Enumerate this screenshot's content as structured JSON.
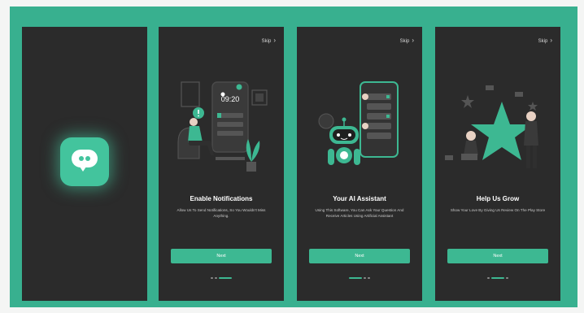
{
  "screens": [
    {
      "type": "splash",
      "app_icon": "chat-bubble-icon"
    },
    {
      "type": "onboarding",
      "skip_label": "Skip",
      "title": "Enable Notifications",
      "description": "Allow Us To Send Notifications, So You Wouldn't Miss Anything.",
      "phone_time": "09:20",
      "next_label": "Next",
      "active_dot": 2
    },
    {
      "type": "onboarding",
      "skip_label": "Skip",
      "title": "Your AI Assistant",
      "description": "Using This Software, You Can Ask Your Question And Receive Articles Using Artificial Assistant",
      "next_label": "Next",
      "active_dot": 0
    },
    {
      "type": "onboarding",
      "skip_label": "Skip",
      "title": "Help Us Grow",
      "description": "Show Your Love By Giving Us Review On The Play Store",
      "next_label": "Next",
      "active_dot": 1
    }
  ],
  "colors": {
    "background": "#38b08f",
    "phone": "#2b2b2b",
    "accent": "#3db892",
    "text": "#ffffff"
  }
}
